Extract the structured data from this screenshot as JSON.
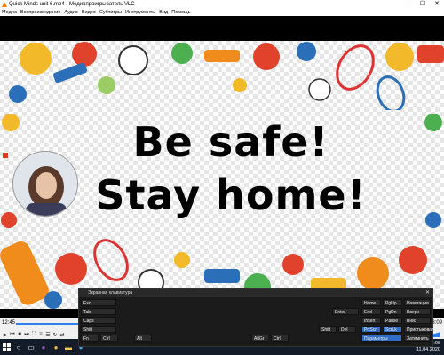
{
  "window": {
    "title": "Quick Minds unit 6.mp4 - Медиапроигрыватель VLC",
    "controls": [
      "—",
      "☐",
      "✕"
    ]
  },
  "menu": [
    "Медиа",
    "Воспроизведение",
    "Аудио",
    "Видео",
    "Субтитры",
    "Инструменты",
    "Вид",
    "Помощь"
  ],
  "video": {
    "line1": "Be safe!",
    "line2": "Stay home!"
  },
  "player": {
    "time_elapsed": "12:45",
    "time_total": "13:09",
    "progress": 0.97
  },
  "osk": {
    "title": "Экранная клавиатура",
    "rows": [
      [
        {
          "label": "Esc"
        }
      ],
      [
        {
          "label": "Tab"
        },
        {
          "label": "Enter"
        }
      ],
      [
        {
          "label": "Caps"
        }
      ],
      [
        {
          "label": "Shift"
        },
        {
          "label": "Shift"
        },
        {
          "label": "Del"
        }
      ],
      [
        {
          "label": "Fn"
        },
        {
          "label": "Ctrl"
        },
        {
          "label": "Alt"
        },
        {
          "label": "AltGr"
        },
        {
          "label": "Ctrl"
        }
      ]
    ],
    "nav_keys": [
      {
        "label": "Home"
      },
      {
        "label": "PgUp"
      },
      {
        "label": "Навигация"
      },
      {
        "label": "End"
      },
      {
        "label": "PgDn"
      },
      {
        "label": "Вверх"
      },
      {
        "label": "Insert"
      },
      {
        "label": "Pause"
      },
      {
        "label": "Вниз"
      },
      {
        "label": "PrtScn"
      },
      {
        "label": "ScrLk"
      },
      {
        "label": "Пристыковать"
      },
      {
        "label": "Параметры"
      },
      {
        "label": "Довод."
      },
      {
        "label": "Затемнить"
      }
    ]
  },
  "taskbar": {
    "time": "13:06",
    "date": "11.04.2020"
  }
}
